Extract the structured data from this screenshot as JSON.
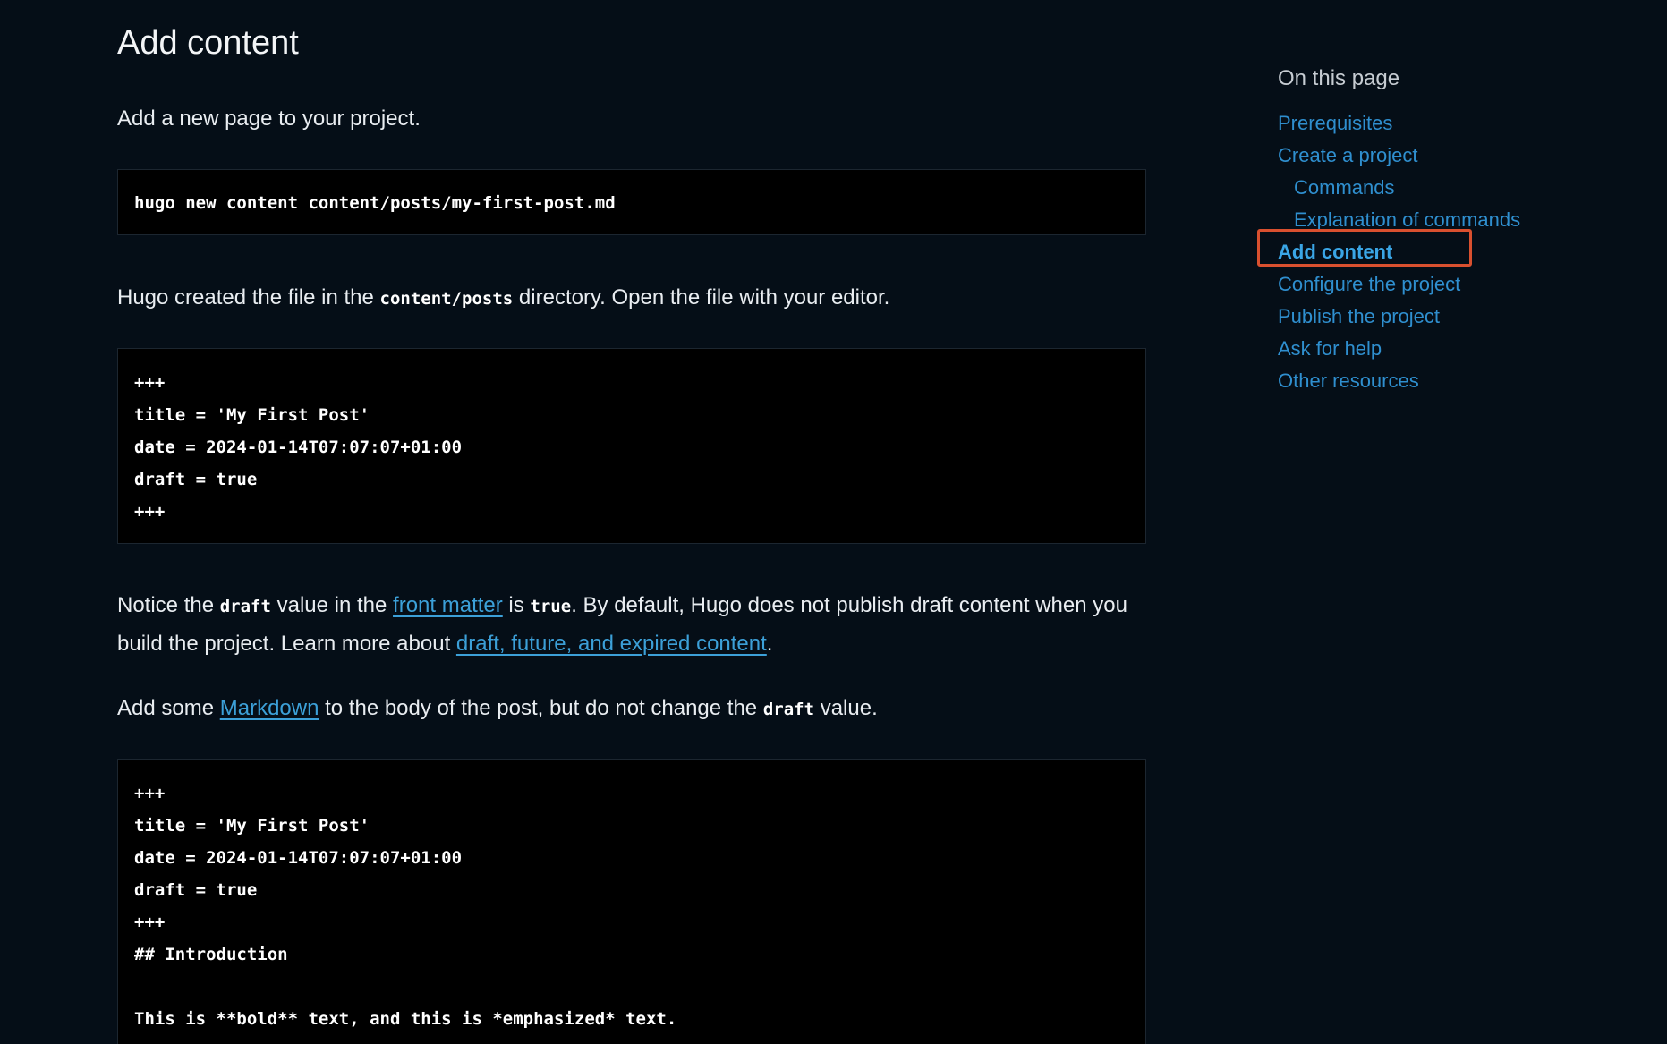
{
  "page": {
    "title": "Add content",
    "intro": "Add a new page to your project.",
    "command": "hugo new content content/posts/my-first-post.md",
    "para1": {
      "before": "Hugo created the file in the ",
      "code": "content/posts",
      "after": " directory. Open the file with your editor."
    },
    "frontmatter_lines": [
      "+++",
      "title = 'My First Post'",
      "date = 2024-01-14T07:07:07+01:00",
      "draft = true",
      "+++"
    ],
    "para2": {
      "t1": "Notice the ",
      "code1": "draft",
      "t2": " value in the ",
      "link1": "front matter",
      "t3": " is ",
      "code2": "true",
      "t4": ". By default, Hugo does not publish draft content when you build the project. Learn more about ",
      "link2": "draft, future, and expired content",
      "t5": "."
    },
    "para3": {
      "t1": "Add some ",
      "link": "Markdown",
      "t2": " to the body of the post, but do not change the ",
      "code": "draft",
      "t3": " value."
    },
    "markdown_lines": [
      "+++",
      "title = 'My First Post'",
      "date = 2024-01-14T07:07:07+01:00",
      "draft = true",
      "+++",
      "## Introduction",
      "",
      "This is **bold** text, and this is *emphasized* text."
    ]
  },
  "toc": {
    "heading": "On this page",
    "items": [
      {
        "label": "Prerequisites"
      },
      {
        "label": "Create a project"
      },
      {
        "label": "Commands"
      },
      {
        "label": "Explanation of commands"
      },
      {
        "label": "Add content"
      },
      {
        "label": "Configure the project"
      },
      {
        "label": "Publish the project"
      },
      {
        "label": "Ask for help"
      },
      {
        "label": "Other resources"
      }
    ]
  }
}
